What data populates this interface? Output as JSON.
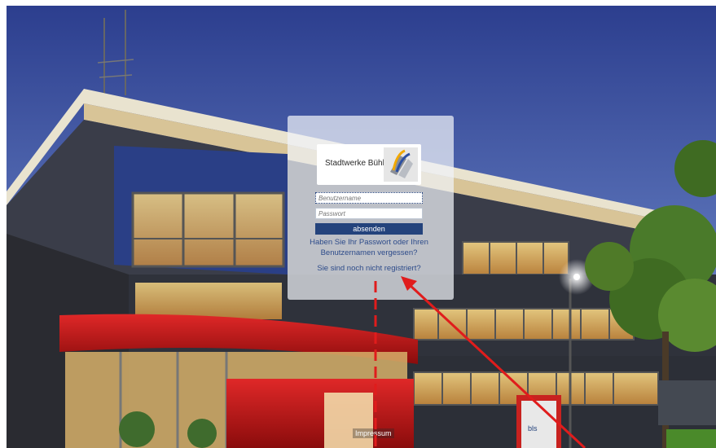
{
  "brand": {
    "name": "Stadtwerke Bühl"
  },
  "login": {
    "username_placeholder": "Benutzername",
    "password_placeholder": "Passwort",
    "submit_label": "absenden",
    "forgot_line1": "Haben Sie Ihr Passwort oder Ihren",
    "forgot_line2": "Benutzernamen vergessen?",
    "register_link": "Sie sind noch nicht registriert?"
  },
  "footer": {
    "impressum": "Impressum",
    "sign_text": "bls"
  },
  "colors": {
    "accent": "#24437c",
    "link": "#2d4b8a",
    "annotation": "#e01c1c"
  }
}
